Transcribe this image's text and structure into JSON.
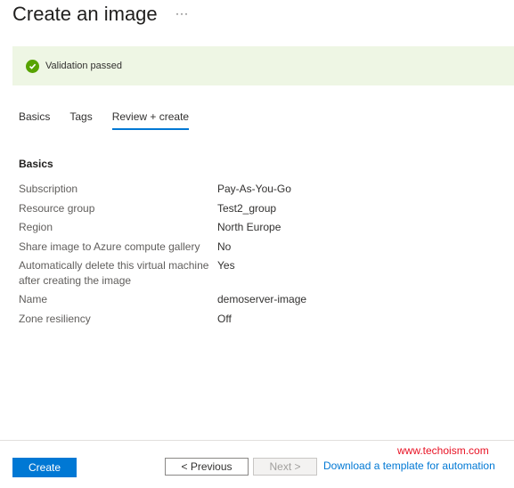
{
  "header": {
    "title": "Create an image",
    "more": "···"
  },
  "banner": {
    "text": "Validation passed",
    "icon": "check-circle-icon",
    "color": "#57a300"
  },
  "tabs": [
    {
      "label": "Basics",
      "active": false
    },
    {
      "label": "Tags",
      "active": false
    },
    {
      "label": "Review + create",
      "active": true
    }
  ],
  "section": {
    "heading": "Basics"
  },
  "details": [
    {
      "label": "Subscription",
      "value": "Pay-As-You-Go"
    },
    {
      "label": "Resource group",
      "value": "Test2_group"
    },
    {
      "label": "Region",
      "value": "North Europe"
    },
    {
      "label": "Share image to Azure compute gallery",
      "value": "No"
    },
    {
      "label": "Automatically delete this virtual machine after creating the image",
      "value": "Yes"
    },
    {
      "label": "Name",
      "value": "demoserver-image"
    },
    {
      "label": "Zone resiliency",
      "value": "Off"
    }
  ],
  "footer": {
    "create_label": "Create",
    "previous_label": "< Previous",
    "next_label": "Next >",
    "template_link": "Download a template for automation",
    "watermark": "www.techoism.com"
  },
  "colors": {
    "accent": "#0078d4",
    "banner_bg": "#eef6e4"
  }
}
